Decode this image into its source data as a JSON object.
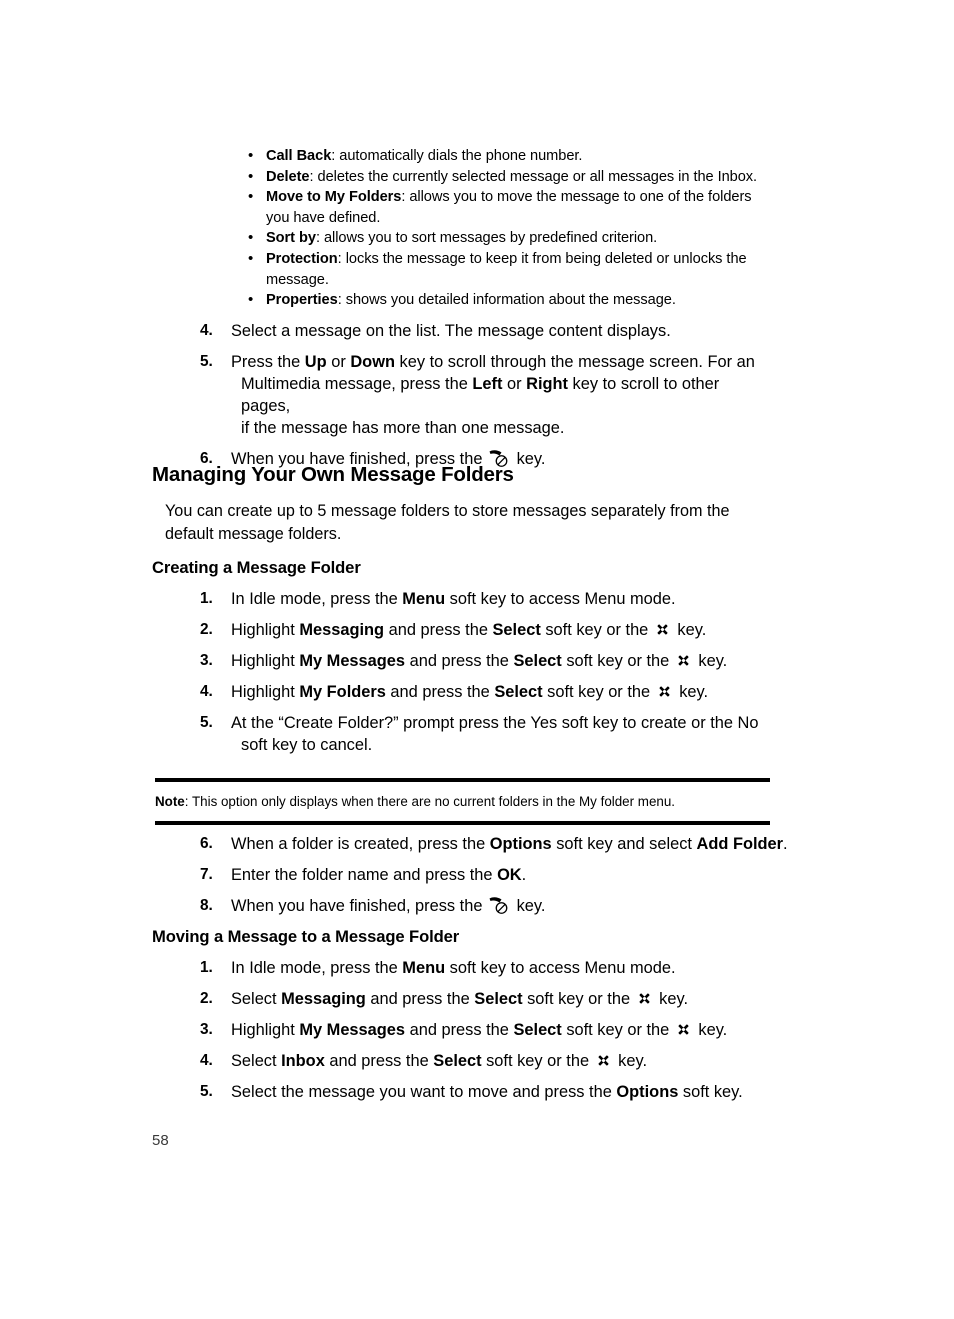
{
  "document": {
    "page_number": "58"
  },
  "bullets": [
    {
      "term": "Call Back",
      "sep": ": ",
      "desc": "automatically dials the phone number."
    },
    {
      "term": "Delete",
      "sep": ": ",
      "desc": "deletes the currently selected message or all messages in the Inbox."
    },
    {
      "term": "Move to My Folders",
      "sep": ": ",
      "desc": "allows you to move the message to one of the folders you have defined."
    },
    {
      "term": "Sort by",
      "sep": ": ",
      "desc": "allows you to sort messages by predefined criterion."
    },
    {
      "term": "Protection",
      "sep": ": ",
      "desc": "locks the message to keep it from being deleted or unlocks the message."
    },
    {
      "term": "Properties",
      "sep": ": ",
      "desc": "shows you detailed information about the message."
    }
  ],
  "top_steps": {
    "step4": {
      "num": "4.",
      "text": "Select a message on the list. The message content displays."
    },
    "step5": {
      "num": "5.",
      "a": "Press the ",
      "b1": "Up",
      "c": " or ",
      "b2": "Down",
      "d": " key to scroll through the message screen. For an",
      "cont_a": "Multimedia message, press the ",
      "b3": "Left",
      "cont_b": " or ",
      "b4": "Right",
      "cont_c": " key to scroll to other pages,",
      "cont_d": "if the message has more than one message."
    },
    "step6": {
      "num": "6.",
      "a": "When you have finished, press the ",
      "icon": "end-call-key-icon",
      "b": " key."
    }
  },
  "section": {
    "title": "Managing Your Own Message Folders",
    "intro": "You can create up to 5 message folders to store messages separately from the default message folders."
  },
  "creating": {
    "title": "Creating a Message Folder",
    "steps": [
      {
        "num": "1.",
        "a": "In Idle mode, press the ",
        "b": "Menu",
        "c": " soft key to access Menu mode.",
        "icon": ""
      },
      {
        "num": "2.",
        "a": "Highlight ",
        "b": "Messaging",
        "c": " and press the ",
        "b2": "Select",
        "d": " soft key or the ",
        "icon": "navigation-key-icon",
        "e": " key."
      },
      {
        "num": "3.",
        "a": "Highlight ",
        "b": "My Messages",
        "c": " and press the ",
        "b2": "Select",
        "d": " soft key or the ",
        "icon": "navigation-key-icon",
        "e": " key."
      },
      {
        "num": "4.",
        "a": "Highlight ",
        "b": "My Folders",
        "c": " and press the ",
        "b2": "Select",
        "d": " soft key or the ",
        "icon": "navigation-key-icon",
        "e": " key."
      },
      {
        "num": "5.",
        "a": "At the “Create Folder?” prompt press the Yes soft key to create or the No",
        "cont": "soft key to cancel."
      }
    ]
  },
  "note": {
    "label": "Note",
    "sep": ": ",
    "text": "This option only displays when there are no current folders in the My folder menu."
  },
  "after_note_steps": [
    {
      "num": "6.",
      "a": "When a folder is created, press the ",
      "b": "Options",
      "c": " soft key and select ",
      "b2": "Add Folder",
      "d": "."
    },
    {
      "num": "7.",
      "a": "Enter the folder name and press the ",
      "b": "OK",
      "c": "."
    },
    {
      "num": "8.",
      "a": "When you have finished, press the ",
      "icon": "end-call-key-icon",
      "c": " key."
    }
  ],
  "moving": {
    "title": "Moving a Message to a Message Folder",
    "steps": [
      {
        "num": "1.",
        "a": "In Idle mode, press the ",
        "b": "Menu",
        "c": " soft key to access Menu mode."
      },
      {
        "num": "2.",
        "a": "Select ",
        "b": "Messaging",
        "c": " and press the ",
        "b2": "Select",
        "d": " soft key or the ",
        "icon": "navigation-key-icon",
        "e": " key."
      },
      {
        "num": "3.",
        "a": "Highlight ",
        "b": "My Messages",
        "c": " and press the ",
        "b2": "Select",
        "d": " soft key or the ",
        "icon": "navigation-key-icon",
        "e": " key."
      },
      {
        "num": "4.",
        "a": "Select ",
        "b": "Inbox",
        "c": " and press the ",
        "b2": "Select",
        "d": " soft key or the ",
        "icon": "navigation-key-icon",
        "e": " key."
      },
      {
        "num": "5.",
        "a": "Select the message you want to move and press the ",
        "b": "Options",
        "c": " soft key."
      }
    ]
  }
}
